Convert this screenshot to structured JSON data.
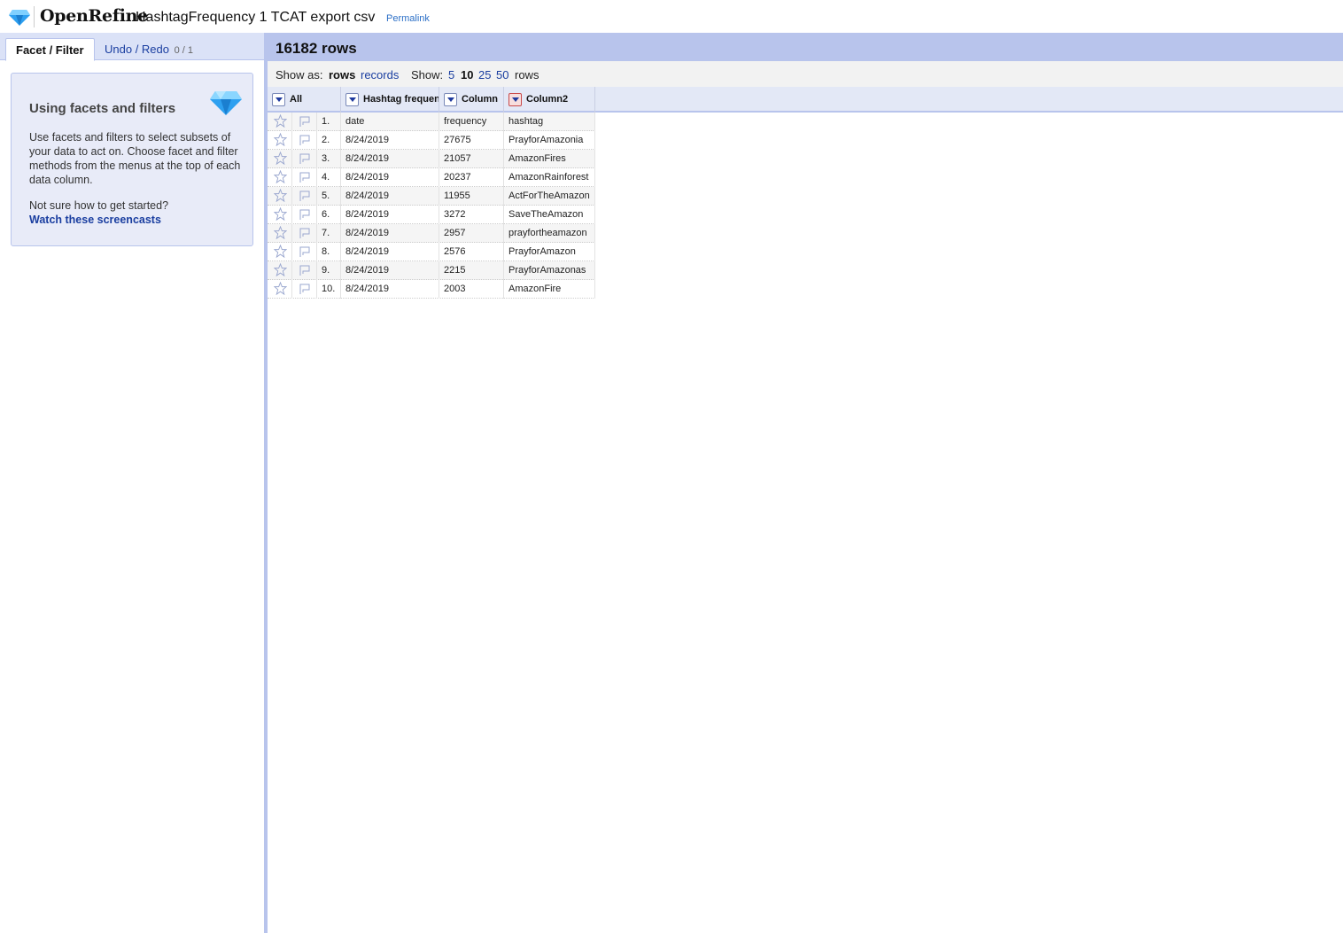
{
  "header": {
    "brand": "OpenRefine",
    "project_name": "HashtagFrequency 1 TCAT export csv",
    "permalink": "Permalink"
  },
  "left_panel": {
    "tabs": [
      {
        "label": "Facet / Filter",
        "active": true
      },
      {
        "label": "Undo / Redo",
        "count": "0 / 1",
        "active": false
      }
    ],
    "help": {
      "title": "Using facets and filters",
      "text": "Use facets and filters to select subsets of your data to act on. Choose facet and filter methods from the menus at the top of each data column.",
      "question": "Not sure how to get started?",
      "link": "Watch these screencasts"
    }
  },
  "summary": {
    "row_count": "16182 rows"
  },
  "view_bar": {
    "show_as_label": "Show as:",
    "rows": "rows",
    "records": "records",
    "show_label": "Show:",
    "page_sizes": [
      "5",
      "10",
      "25",
      "50"
    ],
    "selected_page_size": "10",
    "rows_suffix": "rows"
  },
  "columns": [
    {
      "name": "All"
    },
    {
      "name": "Hashtag frequency"
    },
    {
      "name": "Column"
    },
    {
      "name": "Column2"
    }
  ],
  "rows": [
    {
      "num": "1.",
      "date": "date",
      "freq": "frequency",
      "tag": "hashtag"
    },
    {
      "num": "2.",
      "date": "8/24/2019",
      "freq": "27675",
      "tag": "PrayforAmazonia"
    },
    {
      "num": "3.",
      "date": "8/24/2019",
      "freq": "21057",
      "tag": "AmazonFires"
    },
    {
      "num": "4.",
      "date": "8/24/2019",
      "freq": "20237",
      "tag": "AmazonRainforest"
    },
    {
      "num": "5.",
      "date": "8/24/2019",
      "freq": "11955",
      "tag": "ActForTheAmazon"
    },
    {
      "num": "6.",
      "date": "8/24/2019",
      "freq": "3272",
      "tag": "SaveTheAmazon"
    },
    {
      "num": "7.",
      "date": "8/24/2019",
      "freq": "2957",
      "tag": "prayfortheamazon"
    },
    {
      "num": "8.",
      "date": "8/24/2019",
      "freq": "2576",
      "tag": "PrayforAmazon"
    },
    {
      "num": "9.",
      "date": "8/24/2019",
      "freq": "2215",
      "tag": "PrayforAmazonas"
    },
    {
      "num": "10.",
      "date": "8/24/2019",
      "freq": "2003",
      "tag": "AmazonFire"
    }
  ],
  "colors": {
    "accent_bar": "#b8c4ec",
    "link": "#1a3ea0",
    "gem": "#2ea0f0"
  }
}
